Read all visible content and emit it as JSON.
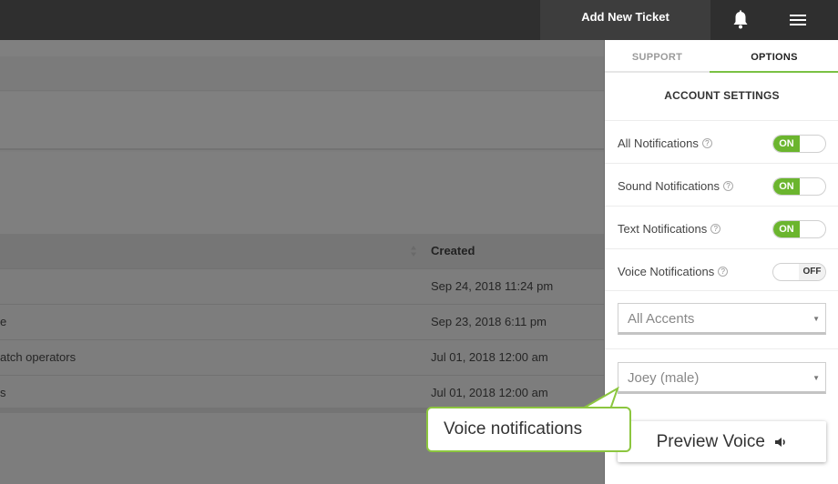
{
  "topbar": {
    "add_ticket_label": "Add New Ticket",
    "icons": [
      "bell-icon",
      "hamburger-menu-icon"
    ]
  },
  "table": {
    "columns": [
      {
        "label": "Created",
        "sortable": true
      }
    ],
    "rows": [
      {
        "title": "",
        "created": "Sep 24, 2018 11:24 pm"
      },
      {
        "title": "e",
        "created": "Sep 23, 2018 6:11 pm"
      },
      {
        "title": "atch operators",
        "created": "Jul 01, 2018 12:00 am"
      },
      {
        "title": "s",
        "created": "Jul 01, 2018 12:00 am"
      }
    ]
  },
  "panel": {
    "tabs": [
      {
        "label": "SUPPORT",
        "active": false
      },
      {
        "label": "OPTIONS",
        "active": true
      }
    ],
    "section_title": "ACCOUNT SETTINGS",
    "settings": [
      {
        "label": "All Notifications",
        "state": "ON"
      },
      {
        "label": "Sound Notifications",
        "state": "ON"
      },
      {
        "label": "Text Notifications",
        "state": "ON"
      },
      {
        "label": "Voice Notifications",
        "state": "OFF"
      }
    ],
    "help_glyph": "?",
    "accent_select": {
      "value": "All Accents"
    },
    "voice_select": {
      "value": "Joey (male)"
    },
    "caret_glyph": "▼",
    "preview_button_label": "Preview Voice"
  },
  "callout": {
    "text": "Voice notifications"
  },
  "colors": {
    "accent_green": "#6bb52e",
    "callout_border": "#8cc63f",
    "topbar": "#2f2f2f"
  }
}
